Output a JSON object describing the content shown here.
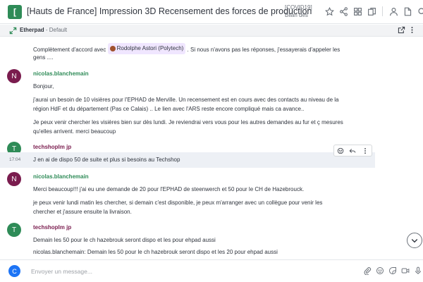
{
  "header": {
    "avatar_letter": "[",
    "title": "[Hauts de France] Impression 3D Recensement des forces de production",
    "topic_line1": "[COVID19]",
    "topic_line2": "Bilan des",
    "icons": [
      "star-icon",
      "share-icon",
      "grid-icon",
      "copy-icon",
      "user-icon",
      "file-icon",
      "search-icon"
    ]
  },
  "etherpad": {
    "title": "Etherpad",
    "separator": " - ",
    "default_label": "Default"
  },
  "messages": {
    "m0": {
      "text_before": "Complètement d'accord avec",
      "mention": "Rodolphe Astori (Polytech)",
      "text_after": ". Si nous n'avons pas les réponses, j'essayerais d'appeler les",
      "text_line2": "gens ...."
    },
    "m1": {
      "avatar_letter": "N",
      "username": "nicolas.blanchemain",
      "p1": "Bonjour,",
      "p2a": "j'aurai un besoin de 10 visières pour l'EPHAD de Merville. Un recensement est en cours avec des contacts au niveau de la",
      "p2b": "région HdF et du département (Pas ce Calais) .. Le lien avec l'ARS reste encore compliqué mais ca avance..",
      "p3a": "Je peux venir chercher les visières bien sur dès lundi. Je reviendrai vers vous pour les autres demandes au fur et ç mesures",
      "p3b": "qu'elles arrivent.  merci beaucoup"
    },
    "m2": {
      "avatar_letter": "T",
      "username": "techshoplm jp",
      "time": "17:04",
      "text": "J en ai de dispo 50 de suite et plus si besoins au Techshop"
    },
    "m3": {
      "avatar_letter": "N",
      "username": "nicolas.blanchemain",
      "p1": "Merci beaucoup!!! j'ai eu une demande de 20 pour l'EPHAD de steenwerch et 50 pour le CH de Hazebrouck.",
      "p2a": "je peux venir lundi matin les chercher, si demain c'est disponible, je peux m'arranger avec un collègue pour venir les",
      "p2b": "chercher et j'assure ensuite la livraison."
    },
    "m4": {
      "avatar_letter": "T",
      "username": "techshoplm jp",
      "p1": "Demain les 50 pour le ch hazebrouk seront dispo et les pour ehpad aussi",
      "p2": "nicolas.blanchemain:  Demain les 50 pour le ch hazebrouk seront dispo et les 20  pour ehpad aussi"
    }
  },
  "composer": {
    "avatar_letter": "C",
    "placeholder": "Envoyer un message..."
  },
  "colors": {
    "room_avatar": "#2e8b57",
    "avatar_n": "#7a1c4e",
    "avatar_t": "#2e8b57",
    "highlight_row": "#edf0f5",
    "composer_avatar": "#1d74f5"
  }
}
